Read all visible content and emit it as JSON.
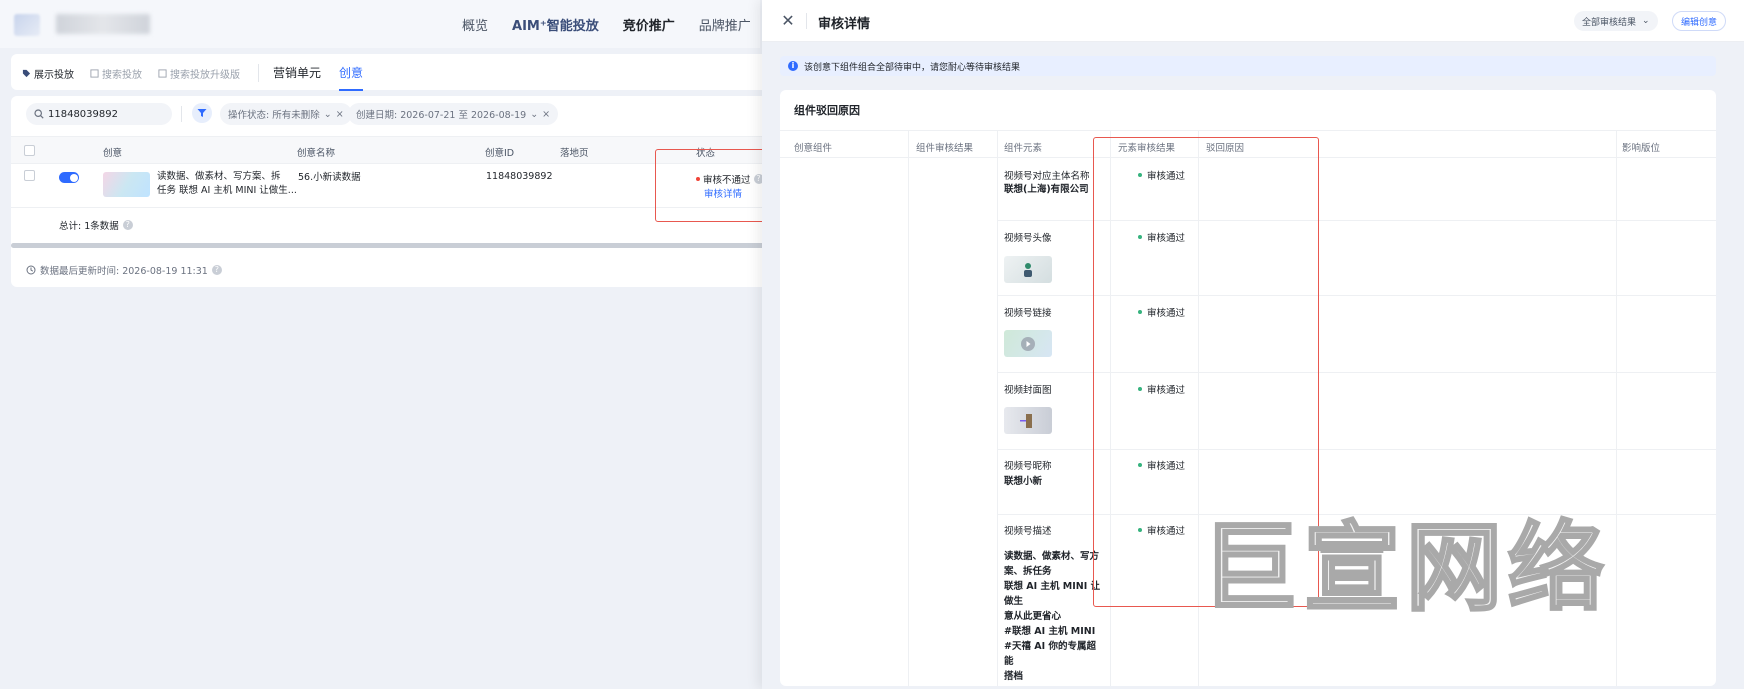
{
  "topnav": {
    "items": [
      "概览",
      "AIM⁺智能投放",
      "竞价推广",
      "品牌推广"
    ]
  },
  "subnav": {
    "pills": [
      "展示投放",
      "搜索投放",
      "搜索投放升级版"
    ],
    "tabs": [
      "营销单元",
      "创意"
    ],
    "active_tab": "创意"
  },
  "filters": {
    "search_value": "11848039892",
    "chip_status": "操作状态: 所有未删除",
    "chip_date": "创建日期: 2026-07-21 至 2026-08-19"
  },
  "table": {
    "headers": [
      "创意",
      "创意名称",
      "创意ID",
      "落地页",
      "状态"
    ],
    "row": {
      "desc_line1": "读数据、做素材、写方案、拆",
      "desc_line2": "任务 联想 AI 主机 MINI 让做生...",
      "name": "56.小新读数据",
      "id": "11848039892",
      "status": "审核不通过",
      "detail_link": "审核详情"
    },
    "total": "总计: 1条数据",
    "updated": "数据最后更新时间: 2026-08-19 11:31"
  },
  "drawer": {
    "title": "审核详情",
    "filter_select": "全部审核结果",
    "edit_button": "编辑创意",
    "notice": "该创意下组件组合全部待审中，请您耐心等待审核结果",
    "panel_title": "组件驳回原因",
    "headers": [
      "创意组件",
      "组件审核结果",
      "组件元素",
      "元素审核结果",
      "驳回原因",
      "影响版位"
    ],
    "rows": [
      {
        "label": "视频号对应主体名称",
        "value": "联想(上海)有限公司",
        "result": "审核通过"
      },
      {
        "label": "视频号头像",
        "value": "",
        "result": "审核通过"
      },
      {
        "label": "视频号链接",
        "value": "",
        "result": "审核通过"
      },
      {
        "label": "视频封面图",
        "value": "",
        "result": "审核通过"
      },
      {
        "label": "视频号昵称",
        "value": "联想小新",
        "result": "审核通过"
      },
      {
        "label": "视频号描述",
        "value_lines": [
          "读数据、做素材、写方",
          "案、拆任务",
          "联想 AI 主机 MINI 让做生",
          "意从此更省心",
          "#联想 AI 主机 MINI",
          "#天禧 AI 你的专属超能",
          "搭档"
        ],
        "result": "审核通过"
      }
    ]
  },
  "watermark": "巨宣网络",
  "colors": {
    "accent": "#2f6bff",
    "error": "#f04438",
    "success": "#36b37e",
    "highlight_box": "#e8584f"
  }
}
